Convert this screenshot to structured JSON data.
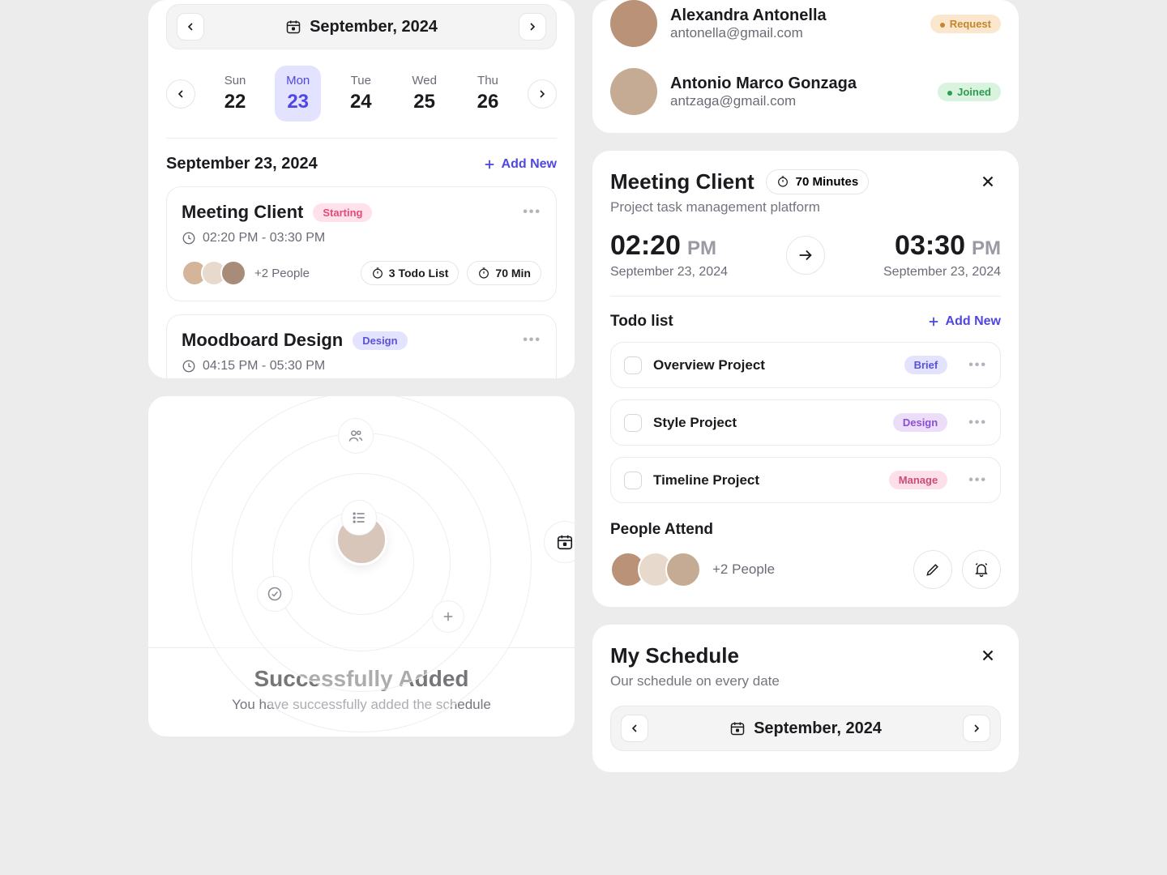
{
  "left": {
    "month_label": "September, 2024",
    "days": [
      {
        "dow": "Sun",
        "num": "22"
      },
      {
        "dow": "Mon",
        "num": "23"
      },
      {
        "dow": "Tue",
        "num": "24"
      },
      {
        "dow": "Wed",
        "num": "25"
      },
      {
        "dow": "Thu",
        "num": "26"
      }
    ],
    "selected_date_full": "September 23, 2024",
    "add_new": "Add New",
    "events": {
      "e1": {
        "title": "Meeting Client",
        "tag": "Starting",
        "time": "02:20 PM - 03:30 PM",
        "plus_people": "+2 People",
        "pill1": "3 Todo List",
        "pill2": "70 Min"
      },
      "e2": {
        "title": "Moodboard Design",
        "tag": "Design",
        "time": "04:15 PM - 05:30 PM"
      }
    }
  },
  "success": {
    "title": "Successfully Added",
    "sub": "You have successfully added the schedule"
  },
  "people": {
    "p1": {
      "name": "Alexandra Antonella",
      "email": "antonella@gmail.com",
      "status": "Request"
    },
    "p2": {
      "name": "Antonio Marco Gonzaga",
      "email": "antzaga@gmail.com",
      "status": "Joined"
    }
  },
  "detail": {
    "title": "Meeting Client",
    "duration": "70 Minutes",
    "subtitle": "Project task management platform",
    "start_time": "02:20",
    "start_ampm": "PM",
    "start_date": "September 23, 2024",
    "end_time": "03:30",
    "end_ampm": "PM",
    "end_date": "September 23, 2024",
    "todo_label": "Todo list",
    "add_new": "Add New",
    "todos": {
      "t1": {
        "title": "Overview Project",
        "tag": "Brief"
      },
      "t2": {
        "title": "Style Project",
        "tag": "Design"
      },
      "t3": {
        "title": "Timeline Project",
        "tag": "Manage"
      }
    },
    "people_label": "People Attend",
    "plus_people": "+2 People"
  },
  "schedule": {
    "title": "My Schedule",
    "sub": "Our schedule on every date",
    "month_label": "September, 2024"
  }
}
